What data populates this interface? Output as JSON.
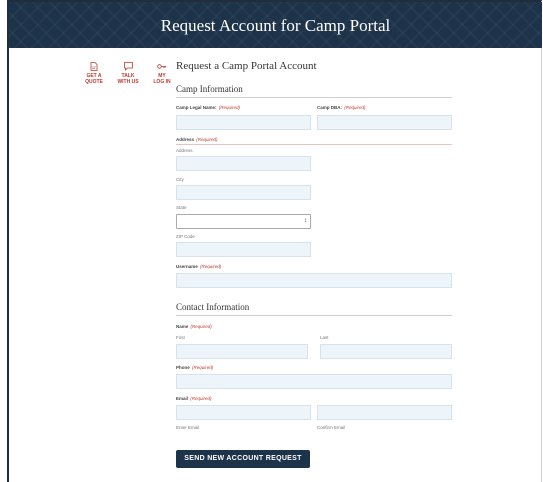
{
  "header": {
    "title": "Request Account for Camp Portal"
  },
  "sidebar": {
    "items": [
      {
        "icon": "document-icon",
        "label_line1": "GET A",
        "label_line2": "QUOTE"
      },
      {
        "icon": "chat-bubble-icon",
        "label_line1": "TALK",
        "label_line2": "WITH US"
      },
      {
        "icon": "key-icon",
        "label_line1": "MY",
        "label_line2": "LOG IN"
      }
    ]
  },
  "form": {
    "title": "Request a Camp Portal Account",
    "camp_section_title": "Camp Information",
    "required_label": "(Required)",
    "legal_name_label": "Camp Legal Name:",
    "dba_label": "Camp DBA:",
    "address_label": "Address",
    "address_sub": "Address",
    "city_sub": "City",
    "state_sub": "State",
    "zip_sub": "ZIP Code",
    "username_label": "Username",
    "contact_section_title": "Contact Information",
    "name_label": "Name",
    "first_sub": "First",
    "last_sub": "Last",
    "phone_label": "Phone",
    "email_label": "Email",
    "enter_email_sub": "Enter Email",
    "confirm_email_sub": "Confirm Email",
    "submit_label": "SEND NEW ACCOUNT REQUEST"
  },
  "colors": {
    "navy": "#1d3349",
    "accent_red": "#c0392b",
    "input_bg": "#eef5fa"
  }
}
